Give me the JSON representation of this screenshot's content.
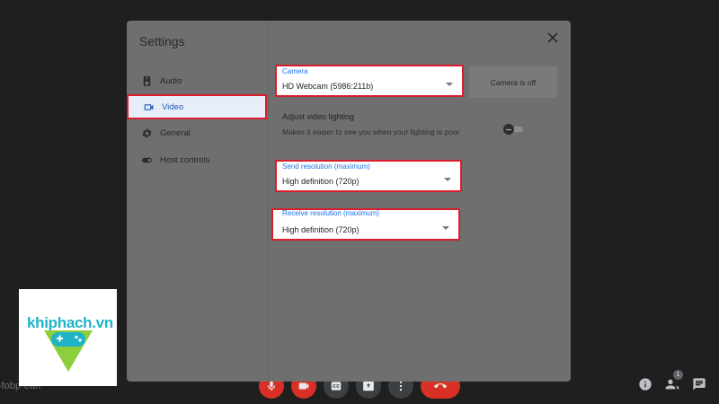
{
  "settings": {
    "title": "Settings",
    "close_label": "close",
    "nav": [
      {
        "label": "Audio",
        "icon": "speaker-icon"
      },
      {
        "label": "Video",
        "icon": "video-camera-icon",
        "active": true
      },
      {
        "label": "General",
        "icon": "gear-icon"
      },
      {
        "label": "Host controls",
        "icon": "toggle-icon"
      }
    ]
  },
  "video": {
    "camera": {
      "label": "Camera",
      "value": "HD Webcam (5986:211b)"
    },
    "camera_preview_text": "Camera is off",
    "lighting": {
      "title": "Adjust video lighting",
      "description": "Makes it easier to see you when your lighting is poor",
      "enabled": false
    },
    "send_resolution": {
      "label": "Send resolution (maximum)",
      "value": "High definition (720p)"
    },
    "receive_resolution": {
      "label": "Receive resolution (maximum)",
      "value": "High definition (720p)"
    }
  },
  "meeting": {
    "code_fragment": "-fobp-ean",
    "participants_count": "1"
  },
  "watermark": {
    "text": "khiphach.vn"
  },
  "colors": {
    "highlight": "#d81e2c",
    "accent": "#1a73e8",
    "hangup": "#d93025"
  }
}
